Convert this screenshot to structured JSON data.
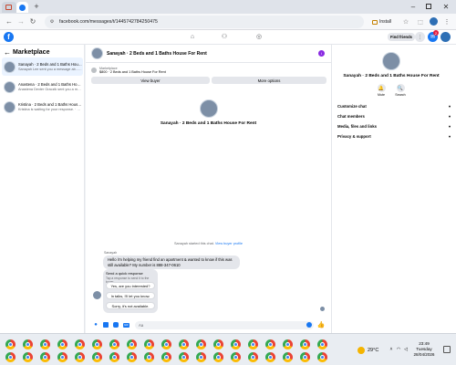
{
  "browser": {
    "url": "facebook.com/messages/t/1445742784250475",
    "install_label": "Install",
    "tab_colors": [
      "#c7462d",
      "#e8ab1d",
      "#1877f2"
    ]
  },
  "fb_header": {
    "find_friends_label": "Find friends",
    "notification_count": "2"
  },
  "left": {
    "title": "Marketplace",
    "conversations": [
      {
        "title": "Sanayah · 2 Beds and 1 Baths House For Rent",
        "preview": "Sanayah Lee sent you a message ab... · 6h"
      },
      {
        "title": "Anastena · 2 Beds and 1 Baths House For ...",
        "preview": "Anastena Dexter Graczik sent you a mes... · 4d"
      },
      {
        "title": "Kristina · 2 Beds and 1 Baths House For Rent",
        "preview": "Kristina is waiting for your response. · 19h"
      }
    ]
  },
  "chat": {
    "header_title": "Sanayah · 2 Beds and 1 Baths House For Rent",
    "listing_seller": "Marketplace",
    "listing_title": "Sanayah · 2 Beds and 1 Baths House For Rent",
    "listing_price": "$800 · 2 Beds and 1 Baths House For Rent",
    "view_buyer_label": "View buyer",
    "more_options_label": "More options",
    "hero_title": "Sanayah · 2 Beds and 1 Baths House For Rent",
    "system_note_prefix": "Sanayah started this chat.",
    "system_note_link": "View buyer profile",
    "sender_name": "Sanayah",
    "message": "Hello i'm helping my friend find an apartment & wanted to know if this was still available? My number is 888-347-0610",
    "quick_response_title": "Send a quick response",
    "quick_response_sub": "Tap a response to send it to the buyer.",
    "quick_replies": [
      "Yes, are you interested?",
      "In talks, I'll let you know.",
      "Sorry, it's not available."
    ],
    "composer_placeholder": "Aa"
  },
  "right": {
    "title": "Sanayah · 2 Beds and 1 Baths House For Rent",
    "mute_label": "Mute",
    "search_label": "Search",
    "sections": [
      "Customize chat",
      "Chat members",
      "Media, files and links",
      "Privacy & support"
    ]
  },
  "taskbar": {
    "temperature": "29°C",
    "time": "23:49",
    "day": "Tuesday",
    "date": "28/04/2026"
  }
}
